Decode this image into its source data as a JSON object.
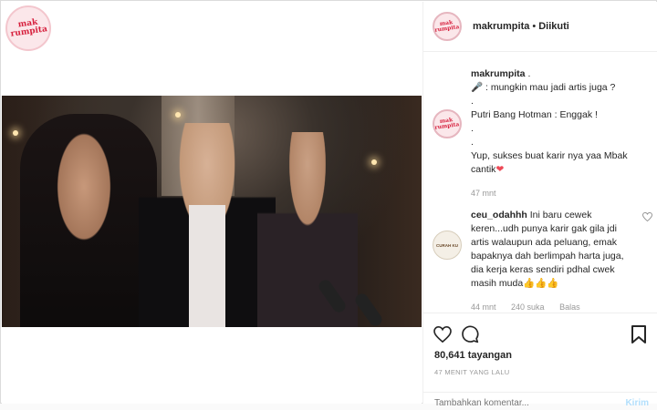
{
  "brand": {
    "logo_text_line1": "mak",
    "logo_text_line2": "rumpita"
  },
  "header": {
    "username": "makrumpita",
    "separator": "•",
    "follow_status": "Diikuti"
  },
  "caption": {
    "username": "makrumpita",
    "lines": [
      ".",
      "🎤 : mungkin mau jadi artis juga ?",
      ".",
      "Putri Bang Hotman : Enggak !",
      ".",
      ".",
      "Yup, sukses buat karir nya yaa Mbak",
      "cantik"
    ],
    "heart": "❤",
    "time": "47 mnt"
  },
  "comment": {
    "username": "ceu_odahhh",
    "avatar_text": "CURAH KU",
    "text": "Ini baru cewek keren...udh punya karir gak gila jdi artis walaupun ada peluang, emak bapaknya dah berlimpah harta juga, dia kerja keras sendiri pdhal cwek masih muda👍👍👍",
    "time": "44 mnt",
    "likes": "240 suka",
    "reply": "Balas"
  },
  "actions": {
    "like_icon": "heart-outline-icon",
    "comment_icon": "comment-bubble-icon",
    "save_icon": "bookmark-icon"
  },
  "stats": {
    "views": "80,641 tayangan",
    "posted": "47 MENIT YANG LALU"
  },
  "add_comment": {
    "placeholder": "Tambahkan komentar...",
    "post_label": "Kirim"
  }
}
